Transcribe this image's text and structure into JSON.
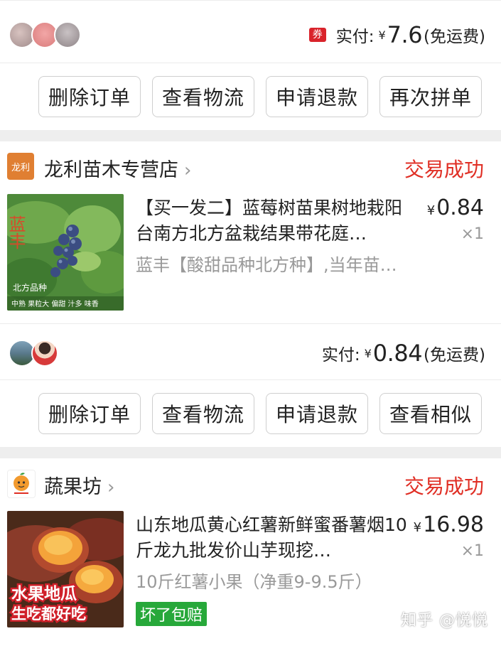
{
  "order1": {
    "coupon": "券",
    "pay_label": "实付:",
    "currency": "¥",
    "amount": "7.6",
    "shipping": "(免运费)",
    "buttons": [
      "删除订单",
      "查看物流",
      "申请退款",
      "再次拼单"
    ]
  },
  "order2": {
    "store_logo_text": "龙利",
    "store_name": "龙利苗木专营店",
    "status": "交易成功",
    "product_title": "【买一发二】蓝莓树苗果树地栽阳台南方北方盆栽结果带花庭…",
    "product_spec": "蓝丰【酸甜品种北方种】,当年苗…",
    "price": "0.84",
    "currency": "¥",
    "qty": "×1",
    "thumb_overlay_title": "蓝丰",
    "thumb_overlay_sub": "北方品种",
    "thumb_overlay_tags": "中熟 果粒大 偏甜 汁多 味香",
    "pay_label": "实付:",
    "amount": "0.84",
    "shipping": "(免运费)",
    "buttons": [
      "删除订单",
      "查看物流",
      "申请退款",
      "查看相似"
    ]
  },
  "order3": {
    "store_name": "蔬果坊",
    "status": "交易成功",
    "product_title": "山东地瓜黄心红薯新鲜蜜番薯烟10斤龙九批发价山芋现挖…",
    "product_spec": "10斤红薯小果（净重9-9.5斤）",
    "price": "16.98",
    "currency": "¥",
    "qty": "×1",
    "badge": "坏了包赔",
    "thumb_overlay_line1": "水果地瓜",
    "thumb_overlay_line2": "生吃都好吃"
  },
  "watermark": "知乎 @悦悦",
  "colors": {
    "accent_red": "#e02e24",
    "badge_green": "#27a83a",
    "coupon_red": "#d9232b"
  }
}
